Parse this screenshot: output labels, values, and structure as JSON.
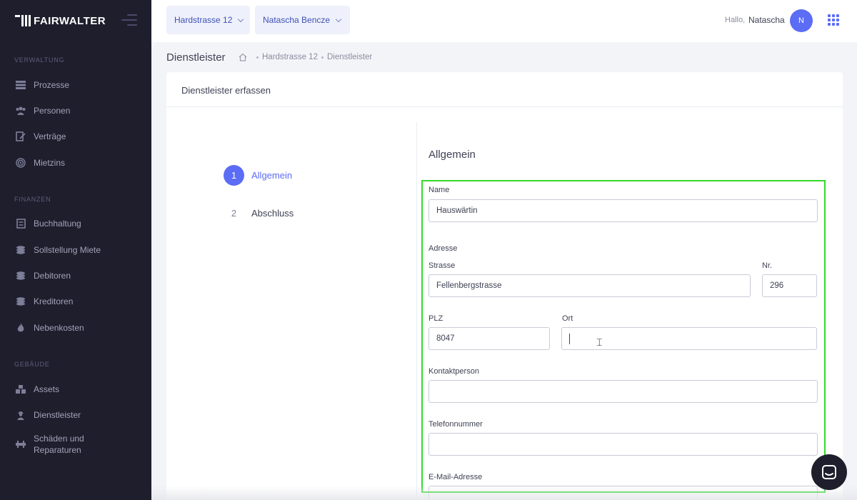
{
  "brand": {
    "name": "FAIRWALTER"
  },
  "sidebar": {
    "sections": [
      {
        "title": "VERWALTUNG",
        "items": [
          {
            "label": "Prozesse",
            "icon": "list-icon"
          },
          {
            "label": "Personen",
            "icon": "people-icon"
          },
          {
            "label": "Verträge",
            "icon": "contract-icon"
          },
          {
            "label": "Mietzins",
            "icon": "fingerprint-icon"
          }
        ]
      },
      {
        "title": "FINANZEN",
        "items": [
          {
            "label": "Buchhaltung",
            "icon": "ledger-icon"
          },
          {
            "label": "Sollstellung Miete",
            "icon": "coins-icon"
          },
          {
            "label": "Debitoren",
            "icon": "coins-icon"
          },
          {
            "label": "Kreditoren",
            "icon": "coins-icon"
          },
          {
            "label": "Nebenkosten",
            "icon": "flame-icon"
          }
        ]
      },
      {
        "title": "GEBÄUDE",
        "items": [
          {
            "label": "Assets",
            "icon": "boxes-icon"
          },
          {
            "label": "Dienstleister",
            "icon": "worker-icon"
          },
          {
            "label": "Schäden und Reparaturen",
            "icon": "tools-icon"
          }
        ]
      }
    ]
  },
  "header": {
    "property_select": "Hardstrasse 12",
    "user_select": "Natascha Bencze",
    "greeting": "Hallo,",
    "user_name": "Natascha",
    "avatar_initial": "N"
  },
  "subheader": {
    "title": "Dienstleister",
    "breadcrumb": [
      "Hardstrasse 12",
      "Dienstleister"
    ]
  },
  "card": {
    "title": "Dienstleister erfassen",
    "steps": [
      {
        "number": "1",
        "label": "Allgemein",
        "active": true
      },
      {
        "number": "2",
        "label": "Abschluss",
        "active": false
      }
    ],
    "form": {
      "section_title": "Allgemein",
      "name_label": "Name",
      "name_value": "Hauswärtin",
      "address_label": "Adresse",
      "street_label": "Strasse",
      "street_value": "Fellenbergstrasse",
      "nr_label": "Nr.",
      "nr_value": "296",
      "plz_label": "PLZ",
      "plz_value": "8047",
      "ort_label": "Ort",
      "ort_value": "",
      "contact_label": "Kontaktperson",
      "contact_value": "",
      "phone_label": "Telefonnummer",
      "phone_value": "",
      "email_label": "E-Mail-Adresse",
      "email_value": ""
    }
  },
  "colors": {
    "accent": "#5b6cf5",
    "sidebar_bg": "#1e1e2d",
    "highlight": "#34d82b"
  }
}
